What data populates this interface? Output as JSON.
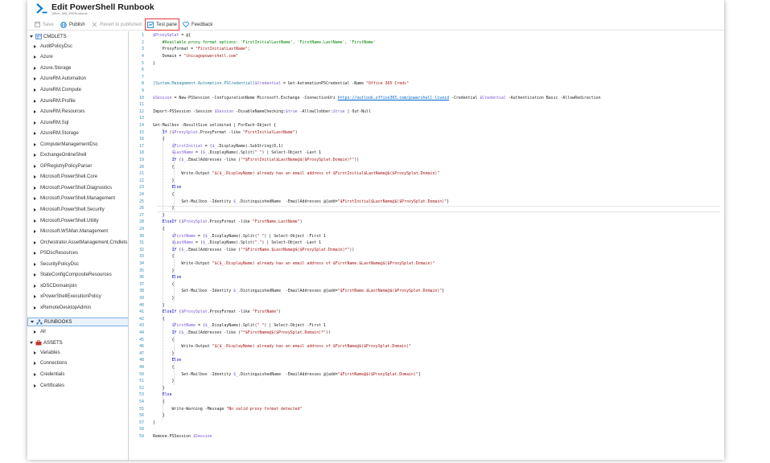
{
  "header": {
    "title": "Edit PowerShell Runbook",
    "subtitle": "Office_365_EM/Runbook",
    "brand_color": "#0078d4"
  },
  "toolbar": {
    "save_label": "Save",
    "publish_label": "Publish",
    "revert_label": "Revert to published",
    "test_label": "Test pane",
    "feedback_label": "Feedback",
    "highlight_color": "#e03a3a"
  },
  "sidebar": {
    "cmdlets_label": "CMDLETS",
    "cmdlets": [
      "AuditPolicyDsc",
      "Azure",
      "Azure.Storage",
      "AzureRM.Automation",
      "AzureRM.Compute",
      "AzureRM.Profile",
      "AzureRM.Resources",
      "AzureRM.Sql",
      "AzureRM.Storage",
      "ComputerManagementDsc",
      "ExchangeOnlineShell",
      "GPRegistryPolicyParser",
      "Microsoft.PowerShell.Core",
      "Microsoft.PowerShell.Diagnostics",
      "Microsoft.PowerShell.Management",
      "Microsoft.PowerShell.Security",
      "Microsoft.PowerShell.Utility",
      "Microsoft.WSMan.Management",
      "Orchestrator.AssetManagement.Cmdlets",
      "PSDscResources",
      "SecurityPolicyDsc",
      "StateConfigCompositeResources",
      "xDSCDomainjoin",
      "xPowerShellExecutionPolicy",
      "xRemoteDesktopAdmin"
    ],
    "runbooks_label": "RUNBOOKS",
    "runbooks": [
      "All"
    ],
    "assets_label": "ASSETS",
    "assets": [
      "Variables",
      "Connections",
      "Credentials",
      "Certificates"
    ]
  },
  "editor": {
    "lines": [
      "$ProxySplat = @{",
      "    #Available proxy format options: 'FirstInitialLastName', 'FirstName.LastName', 'FirstName'",
      "    ProxyFormat = \"FirstInitialLastName\";",
      "    Domain = \"chicagopowershell.com\"",
      "}",
      "",
      "",
      "[System.Management.Automation.PSCredential]$Credential = Get-AutomationPSCredential -Name \"Office 365 Creds\"",
      "",
      "$Session = New-PSSession -ConfigurationName Microsoft.Exchange -ConnectionUri https://outlook.office365.com/powershell-liveid -Credential $Credential -Authentication Basic -AllowRedirection",
      "",
      "Import-PSSession -Session $Session -DisableNameChecking:$true -AllowClobber:$true | Out-Null",
      "",
      "Get-Mailbox -ResultSize unlimited | ForEach-Object {",
      "    If ($ProxySplat.ProxyFormat -like \"FirstInitialLastName\")",
      "    {",
      "        $FirstInitial = ($_.DisplayName).SubString(0,1)",
      "        $LastName = ($_.DisplayName).Split(\" \") | Select-Object -Last 1",
      "        If ($_.EmailAddresses -like (\"*$FirstInitial$LastName@$($ProxySplat.Domain)*\"))",
      "        {",
      "            Write-Output \"$($_.DisplayName) already has an email address of $FirstInitial$LastName@$($ProxySplat.Domain)\"",
      "        }",
      "        Else",
      "        {",
      "            Set-Mailbox -Identity $_.DistinguishedName  -EmailAddresses @{add=\"$FirstInitial$LastName@$($ProxySplat.Domain)\"}",
      "        }",
      "    }",
      "    ElseIf ($ProxySplat.ProxyFormat -like \"FirstName.LastName\")",
      "    {",
      "        $FirstName = ($_.DisplayName).Split(\" \") | Select-Object -First 1",
      "        $LastName = ($_.DisplayName).Split(\".\") | Select-Object -Last 1",
      "        If ($_.EmailAddresses -like (\"*$FirstName.$LastName@$($ProxySplat.Domain)*\"))",
      "        {",
      "            Write-Output \"$($_.DisplayName) already has an email address of $FirstName.$LastName@$($ProxySplat.Domain)\"",
      "        }",
      "        Else",
      "        {",
      "            Set-Mailbox -Identity $_.DistinguishedName  -EmailAddresses @{add=\"$FirstName.$LastName@$($ProxySplat.Domain)\"}",
      "        }",
      "    }",
      "    ElseIf ($ProxySplat.ProxyFormat -like \"FirstName\")",
      "    {",
      "        $FirstName = ($_.DisplayName).Split(\" \") | Select-Object -First 1",
      "        If ($_.EmailAddresses -like (\"*$FirstName@$($ProxySplat.Domain)*\"))",
      "        {",
      "            Write-Output \"$($_.DisplayName) already has an email address of $FirstName@$($ProxySplat.Domain)\"",
      "        }",
      "        Else",
      "        {",
      "            Set-Mailbox -Identity $_.DistinguishedName  -EmailAddresses @{add=\"$FirstName@$($ProxySplat.Domain)\"}",
      "        }",
      "    }",
      "    Else",
      "    {",
      "        Write-Warning -Message \"No valid proxy format detected\"",
      "    }",
      "}",
      "",
      "Remove-PSSession $Session"
    ]
  }
}
